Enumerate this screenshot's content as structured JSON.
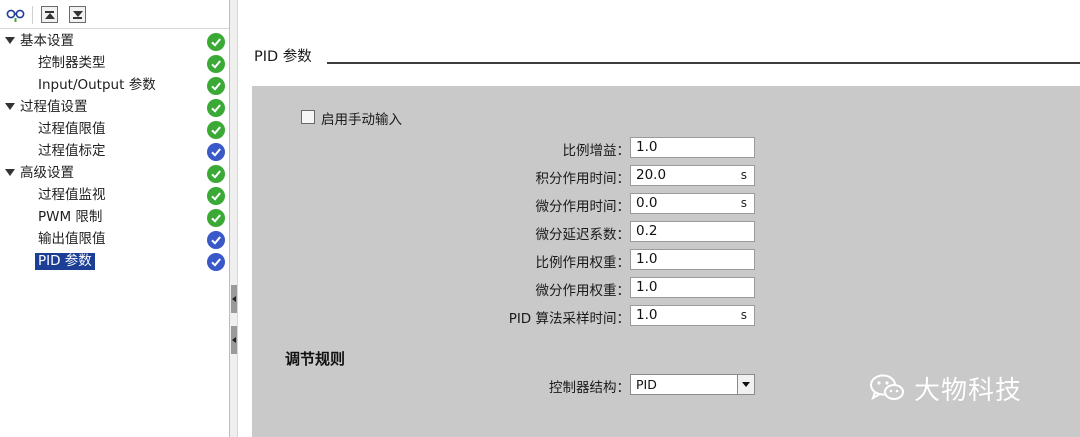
{
  "toolbar": {
    "icons": [
      "glasses-icon",
      "move-up-icon",
      "move-down-icon"
    ]
  },
  "tree": {
    "items": [
      {
        "label": "基本设置",
        "level": 0,
        "expanded": true,
        "status": "green"
      },
      {
        "label": "控制器类型",
        "level": 1,
        "status": "green"
      },
      {
        "label": "Input/Output 参数",
        "level": 1,
        "status": "green"
      },
      {
        "label": "过程值设置",
        "level": 0,
        "expanded": true,
        "status": "green"
      },
      {
        "label": "过程值限值",
        "level": 1,
        "status": "green"
      },
      {
        "label": "过程值标定",
        "level": 1,
        "status": "blue"
      },
      {
        "label": "高级设置",
        "level": 0,
        "expanded": true,
        "status": "green"
      },
      {
        "label": "过程值监视",
        "level": 1,
        "status": "green"
      },
      {
        "label": "PWM 限制",
        "level": 1,
        "status": "green"
      },
      {
        "label": "输出值限值",
        "level": 1,
        "status": "blue"
      },
      {
        "label": "PID 参数",
        "level": 1,
        "status": "blue",
        "selected": true
      }
    ]
  },
  "section": {
    "title": "PID 参数"
  },
  "manual_entry": {
    "label": "启用手动输入",
    "checked": false
  },
  "params": [
    {
      "label": "比例增益：",
      "value": "1.0",
      "unit": ""
    },
    {
      "label": "积分作用时间：",
      "value": "20.0",
      "unit": "s"
    },
    {
      "label": "微分作用时间：",
      "value": "0.0",
      "unit": "s"
    },
    {
      "label": "微分延迟系数：",
      "value": "0.2",
      "unit": ""
    },
    {
      "label": "比例作用权重：",
      "value": "1.0",
      "unit": ""
    },
    {
      "label": "微分作用权重：",
      "value": "1.0",
      "unit": ""
    },
    {
      "label": "PID 算法采样时间：",
      "value": "1.0",
      "unit": "s"
    }
  ],
  "control_rule": {
    "title": "调节规则",
    "structure_label": "控制器结构：",
    "structure_value": "PID"
  },
  "watermark": {
    "text": "大物科技"
  },
  "colors": {
    "status_green": "#3aa936",
    "status_blue": "#3a59c9",
    "selection": "#1c3f95",
    "panel": "#c9c9c9"
  }
}
